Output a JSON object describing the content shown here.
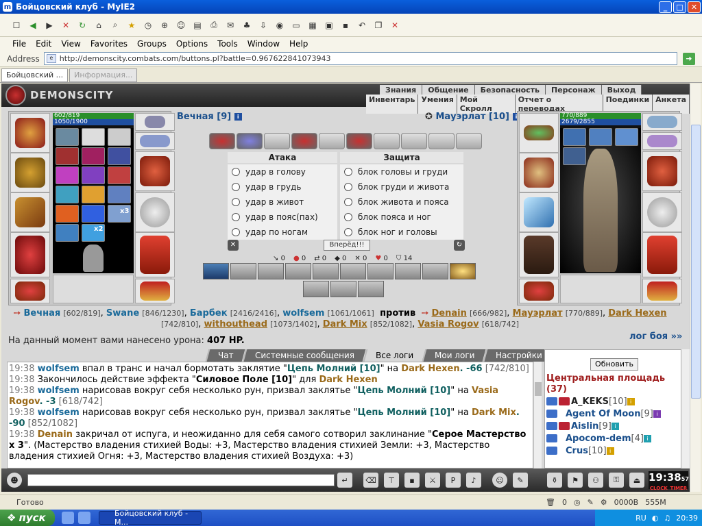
{
  "window": {
    "title": "Бойцовский клуб - MyIE2"
  },
  "menu": [
    "File",
    "Edit",
    "View",
    "Favorites",
    "Groups",
    "Options",
    "Tools",
    "Window",
    "Help"
  ],
  "address": {
    "label": "Address",
    "url": "http://demonscity.combats.com/buttons.pl?battle=0.967622841073943"
  },
  "tabs": [
    {
      "label": "Бойцовский ..."
    },
    {
      "label": "Информация..."
    }
  ],
  "game": {
    "logo": "DEMONSCITY",
    "nav_top": [
      "Знания",
      "Общение",
      "Безопасность",
      "Персонаж",
      "Выход"
    ],
    "nav_bottom": [
      "Инвентарь",
      "Умения",
      "Мой Скролл",
      "Отчет о переводах",
      "Поединки",
      "Анкета"
    ],
    "left_char": {
      "name": "Вечная [9]",
      "hp": "602/819",
      "mp": "1050/1900"
    },
    "right_char": {
      "name": "Мауэрлат [10]",
      "hp": "770/889",
      "mp": "2679/2855"
    },
    "badge_x3": "x3",
    "badge_x2": "x2",
    "attack": {
      "title": "Атака",
      "options": [
        "удар в голову",
        "удар в грудь",
        "удар в живот",
        "удар в пояс(пах)",
        "удар по ногам"
      ]
    },
    "defend": {
      "title": "Защита",
      "options": [
        "блок головы и груди",
        "блок груди и живота",
        "блок живота и пояса",
        "блок пояса и ног",
        "блок ног и головы"
      ]
    },
    "forward_button": "Вперёд!!!",
    "stats": [
      "0",
      "0",
      "0",
      "0",
      "0",
      "0",
      "14"
    ],
    "team_left": [
      {
        "name": "Вечная",
        "hp": "[602/819]"
      },
      {
        "name": "Swane",
        "hp": "[846/1230]"
      },
      {
        "name": "Барбек",
        "hp": "[2416/2416]"
      },
      {
        "name": "wolfsem",
        "hp": "[1061/1061]"
      }
    ],
    "vs": "против",
    "team_right": [
      {
        "name": "Denain",
        "hp": "[666/982]"
      },
      {
        "name": "Мауэрлат",
        "hp": "[770/889]"
      },
      {
        "name": "Dark Hexen",
        "hp": "[742/810]"
      },
      {
        "name": "withouthead",
        "hp": "[1073/1402]"
      },
      {
        "name": "Dark Mix",
        "hp": "[852/1082]"
      },
      {
        "name": "Vasia Rogov",
        "hp": "[618/742]"
      }
    ],
    "damage_text": "На данный момент вами нанесено урона:",
    "damage_value": "407 HP.",
    "log_link": "лог боя »»",
    "chat_tabs": [
      "Чат",
      "Системные сообщения",
      "Все логи",
      "Мои логи",
      "Настройки"
    ],
    "chat_lines": [
      {
        "time": "19:38",
        "who": "wolfsem",
        "text": " впал в транс и начал бормотать заклятие \"",
        "spell": "Цепь Молний [10]",
        "text2": "\" на ",
        "target": "Dark Hexen",
        "dmg": ". -66",
        "hp": "[742/810]"
      },
      {
        "time": "19:38",
        "who": "",
        "text": " Закончилось действие эффекта \"",
        "spell": "Силовое Поле [10]",
        "text2": "\" для ",
        "target": "Dark Hexen",
        "dmg": "",
        "hp": ""
      },
      {
        "time": "19:38",
        "who": "wolfsem",
        "text": " нарисовав вокруг себя несколько рун, призвал заклятье \"",
        "spell": "Цепь Молний [10]",
        "text2": "\" на ",
        "target": "Vasia Rogov",
        "dmg": ". -3",
        "hp": "[618/742]"
      },
      {
        "time": "19:38",
        "who": "wolfsem",
        "text": " нарисовав вокруг себя несколько рун, призвал заклятье \"",
        "spell": "Цепь Молний [10]",
        "text2": "\" на ",
        "target": "Dark Mix",
        "dmg": ". -90",
        "hp": "[852/1082]"
      },
      {
        "time": "19:38",
        "who": "Denain",
        "text": " закричал от испуга, и неожиданно для себя самого сотворил заклинание \"",
        "spell": "Серое Мастерство x 3",
        "text2": "\". (Мастерство владения стихией Воды: +3, Мастерство владения стихией Земли: +3, Мастерство владения стихией Огня: +3, Мастерство владения стихией Воздуха: +3)",
        "target": "",
        "dmg": "",
        "hp": ""
      }
    ],
    "room": {
      "refresh": "Обновить",
      "name": "Центральная площадь",
      "count": "(37)",
      "users": [
        {
          "name": "A_KEKS",
          "level": "[10]"
        },
        {
          "name": "Agent Of Moon",
          "level": "[9]"
        },
        {
          "name": "Aislin",
          "level": "[9]"
        },
        {
          "name": "Apocom-dem",
          "level": "[4]"
        },
        {
          "name": "Crus",
          "level": "[10]"
        }
      ]
    },
    "clock": {
      "time": "19:38",
      "seconds": "57",
      "labels": [
        "CLOCK",
        "TIMER"
      ]
    }
  },
  "statusbar": {
    "text": "Готово",
    "counter": "0",
    "mem1": "0000B",
    "mem2": "555M"
  },
  "taskbar": {
    "start": "пуск",
    "item": "Бойцовский клуб - M...",
    "lang": "RU",
    "time": "20:39"
  }
}
